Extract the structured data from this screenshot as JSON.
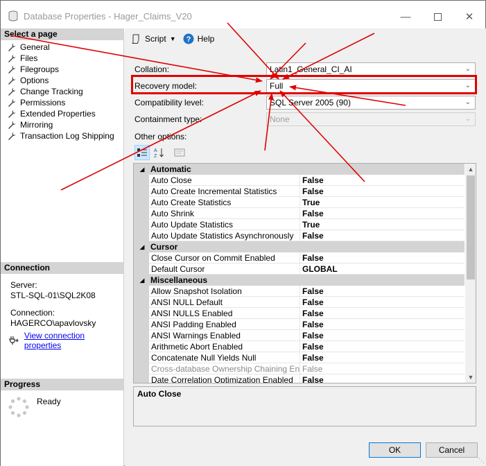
{
  "window": {
    "title": "Database Properties - Hager_Claims_V20",
    "min_icon": "minimize-icon",
    "max_icon": "maximize-icon",
    "close_icon": "close-icon"
  },
  "left_pane": {
    "select_page_header": "Select a page",
    "pages": [
      {
        "label": "General"
      },
      {
        "label": "Files"
      },
      {
        "label": "Filegroups"
      },
      {
        "label": "Options"
      },
      {
        "label": "Change Tracking"
      },
      {
        "label": "Permissions"
      },
      {
        "label": "Extended Properties"
      },
      {
        "label": "Mirroring"
      },
      {
        "label": "Transaction Log Shipping"
      }
    ],
    "connection_header": "Connection",
    "server_label": "Server:",
    "server_value": "STL-SQL-01\\SQL2K08",
    "connection_label": "Connection:",
    "connection_value": "HAGERCO\\apavlovsky",
    "view_connection_link": "View connection properties",
    "progress_header": "Progress",
    "progress_status": "Ready"
  },
  "toolbar": {
    "script_label": "Script",
    "help_label": "Help"
  },
  "form": {
    "collation_label": "Collation:",
    "collation_value": "Latin1_General_CI_AI",
    "recovery_label": "Recovery model:",
    "recovery_value": "Full",
    "compat_label": "Compatibility level:",
    "compat_value": "SQL Server 2005 (90)",
    "containment_label": "Containment type:",
    "containment_value": "None",
    "other_options_label": "Other options:"
  },
  "grid": {
    "categories": [
      {
        "name": "Automatic",
        "rows": [
          {
            "name": "Auto Close",
            "value": "False"
          },
          {
            "name": "Auto Create Incremental Statistics",
            "value": "False"
          },
          {
            "name": "Auto Create Statistics",
            "value": "True"
          },
          {
            "name": "Auto Shrink",
            "value": "False"
          },
          {
            "name": "Auto Update Statistics",
            "value": "True"
          },
          {
            "name": "Auto Update Statistics Asynchronously",
            "value": "False"
          }
        ]
      },
      {
        "name": "Cursor",
        "rows": [
          {
            "name": "Close Cursor on Commit Enabled",
            "value": "False"
          },
          {
            "name": "Default Cursor",
            "value": "GLOBAL"
          }
        ]
      },
      {
        "name": "Miscellaneous",
        "rows": [
          {
            "name": "Allow Snapshot Isolation",
            "value": "False"
          },
          {
            "name": "ANSI NULL Default",
            "value": "False"
          },
          {
            "name": "ANSI NULLS Enabled",
            "value": "False"
          },
          {
            "name": "ANSI Padding Enabled",
            "value": "False"
          },
          {
            "name": "ANSI Warnings Enabled",
            "value": "False"
          },
          {
            "name": "Arithmetic Abort Enabled",
            "value": "False"
          },
          {
            "name": "Concatenate Null Yields Null",
            "value": "False"
          },
          {
            "name": "Cross-database Ownership Chaining Enabled",
            "value": "False",
            "dim": true
          },
          {
            "name": "Date Correlation Optimization Enabled",
            "value": "False"
          }
        ]
      }
    ],
    "description_title": "Auto Close"
  },
  "footer": {
    "ok_label": "OK",
    "cancel_label": "Cancel"
  },
  "colors": {
    "annotation_red": "#e00000",
    "link_blue": "#0000ee",
    "selection_blue": "#cce8ff"
  }
}
